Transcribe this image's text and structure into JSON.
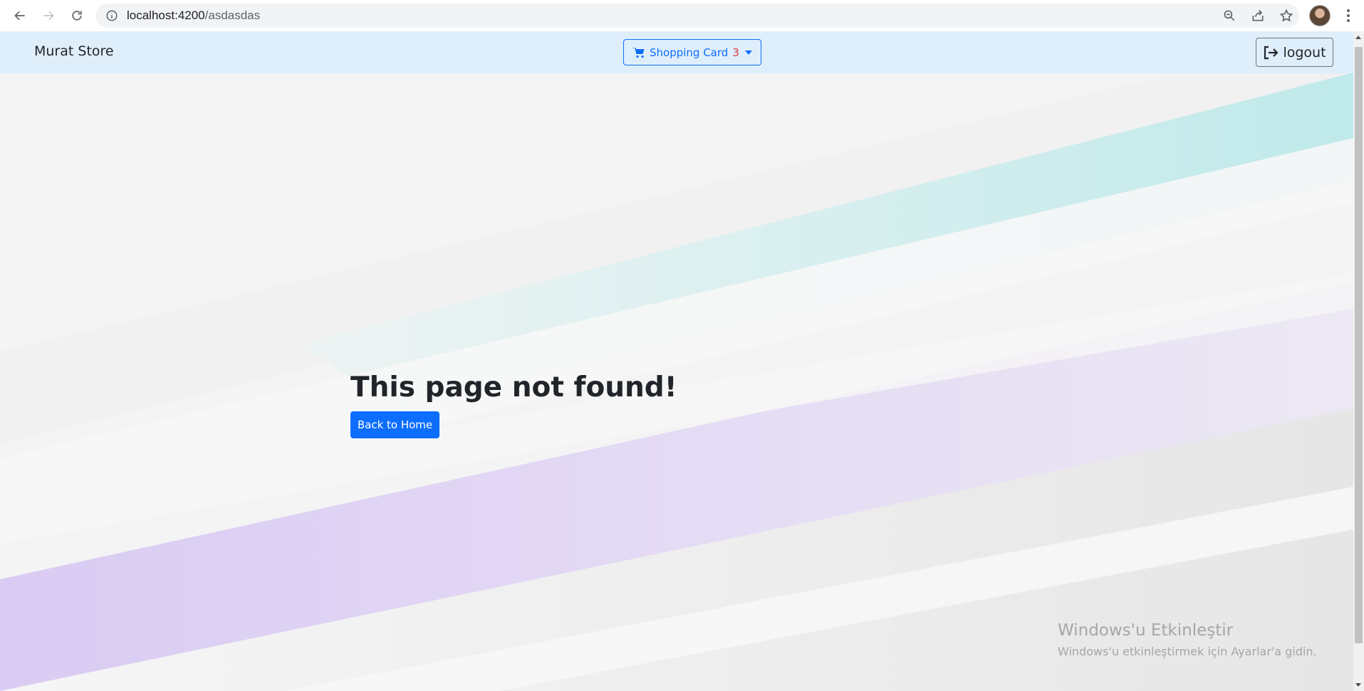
{
  "browser": {
    "url_host": "localhost:4200",
    "url_path": "/asdasdas",
    "icons": [
      "back-icon",
      "forward-icon",
      "reload-icon",
      "info-icon",
      "zoom-icon",
      "share-icon",
      "bookmark-star-icon",
      "profile-avatar",
      "menu-kebab-icon"
    ]
  },
  "navbar": {
    "brand": "Murat Store",
    "cart_label": "Shopping Card",
    "cart_count": "3",
    "logout_label": "logout"
  },
  "main": {
    "title": "This page not found!",
    "home_button": "Back to Home"
  },
  "watermark": {
    "title": "Windows'u Etkinleştir",
    "subtitle": "Windows'u etkinleştirmek için Ayarlar'a gidin."
  },
  "colors": {
    "primary": "#0d6efd",
    "navbar_bg": "#dfeefb",
    "badge": "#dc3545",
    "stripe_teal": "#bfe9ea",
    "stripe_purple": "#dcd0f5"
  }
}
